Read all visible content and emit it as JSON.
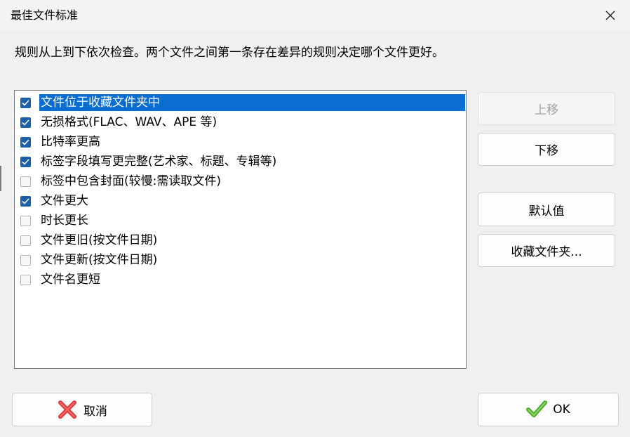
{
  "window": {
    "title": "最佳文件标准",
    "close_icon": "close-icon"
  },
  "description": "规则从上到下依次检查。两个文件之间第一条存在差异的规则决定哪个文件更好。",
  "criteria": [
    {
      "label": "文件位于收藏文件夹中",
      "checked": true,
      "selected": true
    },
    {
      "label": "无损格式(FLAC、WAV、APE 等)",
      "checked": true,
      "selected": false
    },
    {
      "label": "比特率更高",
      "checked": true,
      "selected": false
    },
    {
      "label": "标签字段填写更完整(艺术家、标题、专辑等)",
      "checked": true,
      "selected": false
    },
    {
      "label": "标签中包含封面(较慢:需读取文件)",
      "checked": false,
      "selected": false
    },
    {
      "label": "文件更大",
      "checked": true,
      "selected": false
    },
    {
      "label": "时长更长",
      "checked": false,
      "selected": false
    },
    {
      "label": "文件更旧(按文件日期)",
      "checked": false,
      "selected": false
    },
    {
      "label": "文件更新(按文件日期)",
      "checked": false,
      "selected": false
    },
    {
      "label": "文件名更短",
      "checked": false,
      "selected": false
    }
  ],
  "side_buttons": {
    "move_up": "上移",
    "move_down": "下移",
    "defaults": "默认值",
    "favorite_folders": "收藏文件夹..."
  },
  "footer": {
    "cancel": "取消",
    "ok": "OK",
    "cancel_icon": "red-x-icon",
    "ok_icon": "green-check-icon"
  },
  "colors": {
    "selection": "#0a6ed1",
    "checkbox_checked": "#1d5fa6",
    "cancel_icon": "#e03a3a",
    "ok_icon": "#4caf2a"
  }
}
